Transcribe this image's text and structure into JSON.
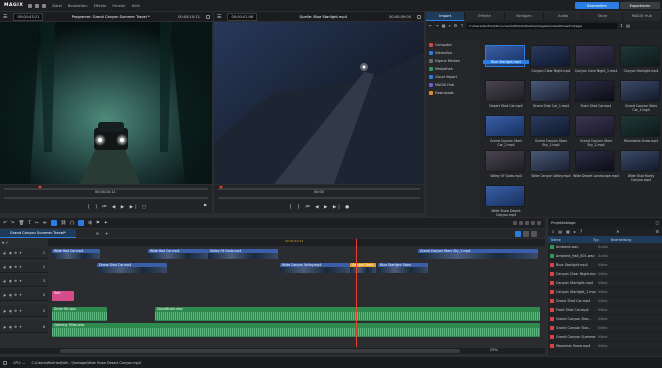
{
  "app": {
    "logo": "MAGIX",
    "menu": [
      "Datei",
      "Bearbeiten",
      "Effekte",
      "Fenster",
      "Hilfe"
    ]
  },
  "topbuttons": {
    "left": "Bearbeiten",
    "right": "Exportieren"
  },
  "program": {
    "tc_left": "00:00:43:21",
    "title": "Programm: Grand Canyon Summer Travel *",
    "tc_right": "00:04:10:11",
    "pos": "00:04:10:11"
  },
  "source": {
    "tc_left": "00:00:01:06",
    "title": "Quelle: Blue Starlight.mp4",
    "tc_right": "00:00:09:00",
    "pos": "00:00"
  },
  "browser": {
    "tabs": [
      "Import",
      "Effekte",
      "Vorlagen",
      "Audio",
      "Store",
      "MAGIX Hub"
    ],
    "path": "C:\\Users\\Winfried\\Documents\\MAGIX\\Desktop\\Vegas\\ContentShow\\Footage\\",
    "side": [
      {
        "label": "Computer",
        "color": "#d64545"
      },
      {
        "label": "Videoclips",
        "color": "#2a7de1"
      },
      {
        "label": "Eigene Medien",
        "color": "#6a6a6a"
      },
      {
        "label": "Mediathek",
        "color": "#2e9a5a"
      },
      {
        "label": "Cloud Import",
        "color": "#2a7de1"
      },
      {
        "label": "MAGIX Hub",
        "color": "#6a5fd1"
      },
      {
        "label": "Downloads",
        "color": "#e08a2c"
      }
    ],
    "thumbs": [
      {
        "label": "Blue Starlight.mp4",
        "sel": true
      },
      {
        "label": "Canyon Clear Night.mp4"
      },
      {
        "label": "Canyon Cave Night_1.mp4"
      },
      {
        "label": "Canyon Starlight.mp4"
      },
      {
        "label": "Desert Shot Car.mp4"
      },
      {
        "label": "Drone Shot Car_1.mp4"
      },
      {
        "label": "Front Shot Car.mp4"
      },
      {
        "label": "Grand Canyon Stars Car_1.mp4"
      },
      {
        "label": "Grand Canyon Stars Car_2.mp4"
      },
      {
        "label": "Grand Canyon Stars Sky_1.mp4"
      },
      {
        "label": "Grand Canyon Stars Sky_2.mp4"
      },
      {
        "label": "Mountains Snow.mp4"
      },
      {
        "label": "Valley Of Gods.mp4"
      },
      {
        "label": "Wide Canyon Valley.mp4"
      },
      {
        "label": "Wide Desert Landscape.mp4"
      },
      {
        "label": "Wide Shot Rocky Canyon.mp4"
      },
      {
        "label": "Wide Snow Desert Canyon.mp4"
      }
    ]
  },
  "timeline": {
    "tab": "Grand Canyon Summer Travel*",
    "playhead_tc": "00:04:10:11",
    "tracks": [
      "1",
      "2",
      "3",
      "4",
      "5",
      "6"
    ],
    "clips": [
      {
        "name": "Wide Rod Car.mp4",
        "cls": "vclip"
      },
      {
        "name": "Wide Rod Car.mp4",
        "cls": "vclip"
      },
      {
        "name": "Valley Of Gods.mp4",
        "cls": "vclip"
      },
      {
        "name": "Grand Canyon Stars Sky_1.mp4",
        "cls": "vclip"
      },
      {
        "name": "Drone Shot Car.mp4",
        "cls": "vclip"
      },
      {
        "name": "Wide Canyon Valley.mp4",
        "cls": "vclip"
      },
      {
        "name": "Canyon Stars",
        "cls": "orange"
      },
      {
        "name": "Blue Starlight Stars",
        "cls": "vclip"
      },
      {
        "name": "Text",
        "cls": "pink"
      },
      {
        "name": "Drum Hit.wav",
        "cls": "audio"
      },
      {
        "name": "Soundtrack.wav",
        "cls": "audio"
      },
      {
        "name": "Opening Titles.wav",
        "cls": "audio"
      }
    ],
    "zoom": "25%",
    "cpu": "CPU: —"
  },
  "project": {
    "title": "Projektablage",
    "cols": [
      "Name",
      "Typ",
      "Bearbeitung"
    ],
    "items": [
      {
        "name": "Ambient.wav",
        "type": "Audio",
        "icon": "g"
      },
      {
        "name": "Ambient_Hall_001.wav",
        "type": "Audio",
        "icon": "g"
      },
      {
        "name": "Blue Starlight.mp4",
        "type": "Video",
        "icon": "r"
      },
      {
        "name": "Canyon Clear Night.mp4",
        "type": "Video",
        "icon": "r"
      },
      {
        "name": "Canyon Starlight.mp4",
        "type": "Video",
        "icon": "r"
      },
      {
        "name": "Canyon Starlight_1.mp4",
        "type": "Video",
        "icon": "r"
      },
      {
        "name": "Drone Shot Car.mp4",
        "type": "Video",
        "icon": "r"
      },
      {
        "name": "Front Shot Car.mp4",
        "type": "Video",
        "icon": "r"
      },
      {
        "name": "Grand Canyon Star...",
        "type": "Video",
        "icon": "r"
      },
      {
        "name": "Grand Canyon Star...",
        "type": "Video",
        "icon": "r"
      },
      {
        "name": "Grand Canyon Summer...",
        "type": "Video",
        "icon": "r"
      },
      {
        "name": "Mountain Snow.mp4",
        "type": "Video",
        "icon": "r"
      }
    ]
  },
  "status": {
    "path": "C:\\Users\\Winfried\\Vall...\\Footage\\Wide Snow Desert Canyon.mp4"
  }
}
